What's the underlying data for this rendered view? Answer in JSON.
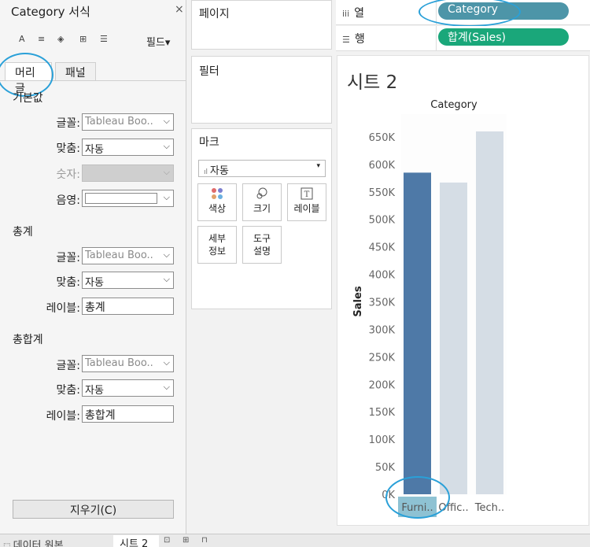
{
  "format_pane": {
    "title": "Category 서식",
    "close_glyph": "×",
    "fields_label": "필드▾",
    "toolbar_icons": [
      "font-icon",
      "align-icon",
      "shading-icon",
      "borders-icon",
      "lines-icon"
    ],
    "tabs": [
      "머리글",
      "패널"
    ],
    "sections": {
      "default": {
        "title": "기본값",
        "font_label": "글꼴:",
        "font_value": "Tableau Boo..",
        "align_label": "맞춤:",
        "align_value": "자동",
        "number_label": "숫자:",
        "shade_label": "음영:"
      },
      "totals": {
        "title": "총계",
        "font_label": "글꼴:",
        "font_value": "Tableau Boo..",
        "align_label": "맞춤:",
        "align_value": "자동",
        "label_label": "레이블:",
        "label_value": "총계"
      },
      "grand_totals": {
        "title": "총합계",
        "font_label": "글꼴:",
        "font_value": "Tableau Boo..",
        "align_label": "맞춤:",
        "align_value": "자동",
        "label_label": "레이블:",
        "label_value": "총합계"
      }
    },
    "clear_button": "지우기(C)"
  },
  "shelves": {
    "pages": "페이지",
    "filters": "필터",
    "marks": {
      "title": "마크",
      "type": "자동",
      "buttons": [
        "색상",
        "크기",
        "레이블",
        "세부\n정보",
        "도구\n설명"
      ]
    },
    "columns_label": "열",
    "rows_label": "행",
    "columns_pill": "Category",
    "rows_pill": "합계(Sales)"
  },
  "sheet": {
    "title": "시트 2"
  },
  "chart_data": {
    "type": "bar",
    "title": "Category",
    "ylabel": "Sales",
    "xlabel": "",
    "categories": [
      "Furni..",
      "Offic..",
      "Tech.."
    ],
    "values": [
      585000,
      567000,
      660000
    ],
    "highlighted_index": 0,
    "colors": {
      "highlighted": "#4e79a7",
      "dimmed": "#d5dde5"
    },
    "ylim": [
      0,
      680000
    ],
    "yticks": [
      0,
      50000,
      100000,
      150000,
      200000,
      250000,
      300000,
      350000,
      400000,
      450000,
      500000,
      550000,
      600000,
      650000
    ],
    "ytick_labels": [
      "0K",
      "50K",
      "100K",
      "150K",
      "200K",
      "250K",
      "300K",
      "350K",
      "400K",
      "450K",
      "500K",
      "550K",
      "600K",
      "650K"
    ],
    "grid": false
  },
  "bottom_tabs": [
    "데이터 원본",
    "시트 2"
  ]
}
